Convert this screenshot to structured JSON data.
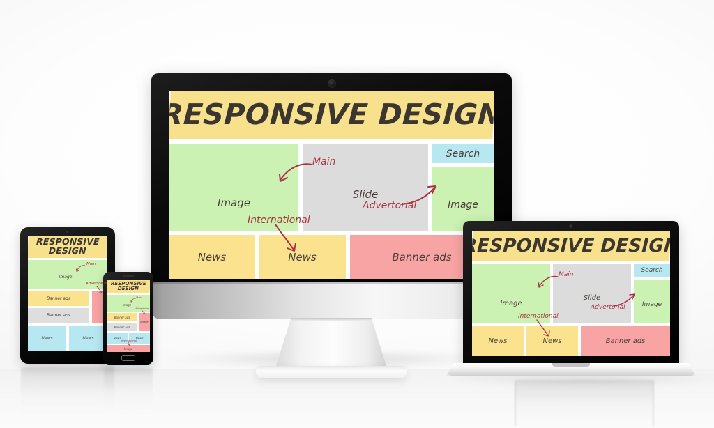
{
  "scene": {
    "background_color": "#ffffff",
    "devices": [
      "desktop-monitor",
      "laptop",
      "tablet",
      "smartphone"
    ]
  },
  "palette": {
    "title_yellow": "#f8e18d",
    "news_yellow": "#fae28e",
    "image_green": "#cbf2b2",
    "slide_grey": "#dcdcdc",
    "banner_grey": "#dedede",
    "search_blue": "#b7e8f2",
    "banner_pink": "#f9a4a4",
    "annotation_red": "#ab3341",
    "text_dark": "#4a4038",
    "bezel_black": "#000000",
    "chassis_silver": "#e8e8e8"
  },
  "monitor": {
    "device_label": "desktop-monitor",
    "title": "RESPONSIVE DESIGN",
    "blocks": [
      {
        "label": "Image",
        "color": "#cbf2b2"
      },
      {
        "label": "Slide",
        "color": "#dcdcdc"
      },
      {
        "label": "Search",
        "color": "#b7e8f2"
      },
      {
        "label": "Image",
        "color": "#cbf2b2"
      },
      {
        "label": "News",
        "color": "#fae28e"
      },
      {
        "label": "News",
        "color": "#fae28e"
      },
      {
        "label": "Banner ads",
        "color": "#f9a4a4"
      }
    ],
    "annotations": [
      {
        "label": "Main",
        "points_to": "Image"
      },
      {
        "label": "Advertorial",
        "points_to": "Image"
      },
      {
        "label": "International",
        "points_to": "News"
      }
    ]
  },
  "laptop": {
    "device_label": "laptop",
    "title": "RESPONSIVE DESIGN",
    "blocks": [
      {
        "label": "Image",
        "color": "#cbf2b2"
      },
      {
        "label": "Slide",
        "color": "#dcdcdc"
      },
      {
        "label": "Search",
        "color": "#b7e8f2"
      },
      {
        "label": "Image",
        "color": "#cbf2b2"
      },
      {
        "label": "News",
        "color": "#fae28e"
      },
      {
        "label": "News",
        "color": "#fae28e"
      },
      {
        "label": "Banner ads",
        "color": "#f9a4a4"
      }
    ],
    "annotations": [
      {
        "label": "Main",
        "points_to": "Image"
      },
      {
        "label": "Advertorial",
        "points_to": "Image"
      },
      {
        "label": "International",
        "points_to": "News"
      }
    ]
  },
  "tablet": {
    "device_label": "tablet",
    "title_line1": "RESPONSIVE",
    "title_line2": "DESIGN",
    "blocks": [
      {
        "label": "Image",
        "color": "#cbf2b2"
      },
      {
        "label": "Banner ads",
        "color": "#fae28e"
      },
      {
        "label": "Banner ads",
        "color": "#dedede"
      },
      {
        "label": "",
        "color": "#f9a4a4"
      },
      {
        "label": "News",
        "color": "#b7e8f2"
      },
      {
        "label": "News",
        "color": "#b7e8f2"
      }
    ],
    "annotations": [
      {
        "label": "Main",
        "points_to": "Image"
      },
      {
        "label": "Advertorial",
        "points_to": "Image"
      }
    ]
  },
  "phone": {
    "device_label": "smartphone",
    "title_line1": "RESPONSIVE",
    "title_line2": "DESIGN",
    "blocks": [
      {
        "label": "Image",
        "color": "#cbf2b2"
      },
      {
        "label": "Banner ads",
        "color": "#fae28e"
      },
      {
        "label": "Banner ads",
        "color": "#dedede"
      },
      {
        "label": "Image",
        "color": "#f9a4a4"
      },
      {
        "label": "News",
        "color": "#b7e8f2"
      },
      {
        "label": "News",
        "color": "#b7e8f2"
      },
      {
        "label": "Image",
        "color": "#f9a4a4"
      }
    ],
    "annotations": [
      {
        "label": "Main",
        "points_to": "Image"
      },
      {
        "label": "Advertorial",
        "points_to": "Image"
      },
      {
        "label": "International",
        "points_to": "News"
      }
    ]
  }
}
